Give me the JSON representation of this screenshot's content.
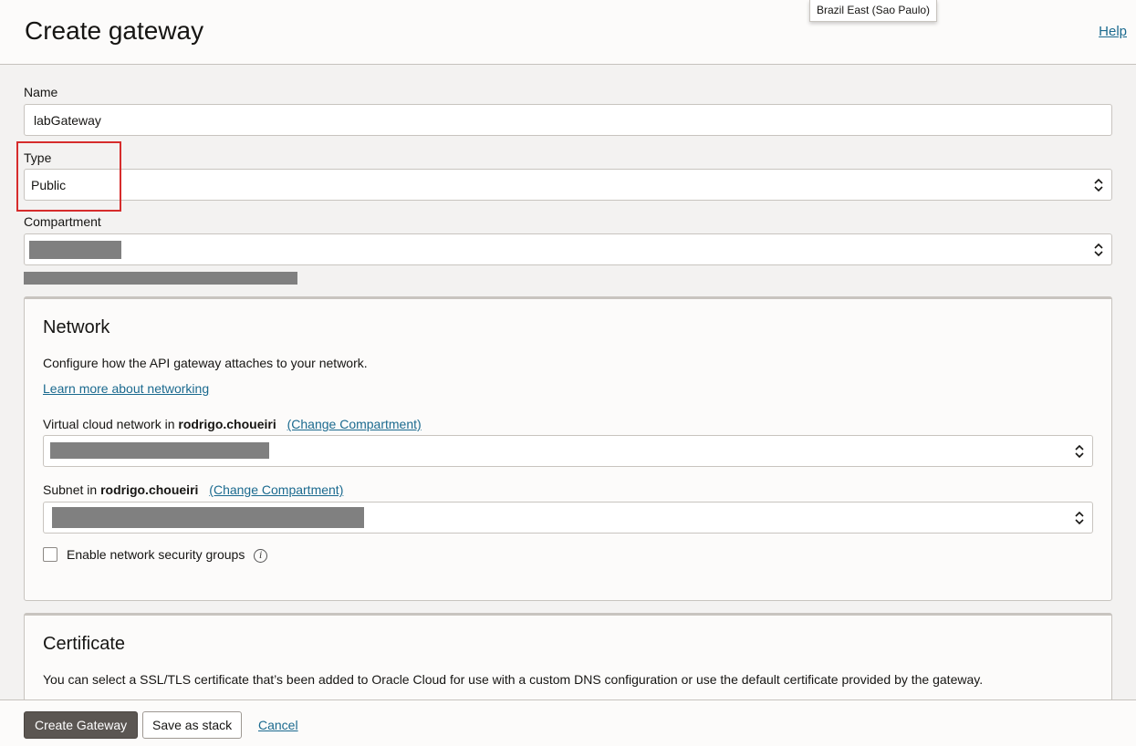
{
  "header": {
    "title": "Create gateway",
    "help_label": "Help",
    "region_tooltip": "Brazil East (Sao Paulo)"
  },
  "form": {
    "name_label": "Name",
    "name_value": "labGateway",
    "type_label": "Type",
    "type_value": "Public",
    "compartment_label": "Compartment"
  },
  "network": {
    "title": "Network",
    "description": "Configure how the API gateway attaches to your network.",
    "learn_more_link": "Learn more about networking",
    "vcn_label_prefix": "Virtual cloud network in",
    "vcn_compartment": "rodrigo.choueiri",
    "vcn_change_link": "(Change Compartment)",
    "subnet_label_prefix": "Subnet in",
    "subnet_compartment": "rodrigo.choueiri",
    "subnet_change_link": "(Change Compartment)",
    "nsg_label": "Enable network security groups",
    "nsg_checked": false
  },
  "certificate": {
    "title": "Certificate",
    "description": "You can select a SSL/TLS certificate that’s been added to Oracle Cloud for use with a custom DNS configuration or use the default certificate provided by the gateway."
  },
  "footer": {
    "create_label": "Create Gateway",
    "save_stack_label": "Save as stack",
    "cancel_label": "Cancel"
  },
  "colors": {
    "link": "#1b6a8f",
    "primary_button": "#5b5652",
    "highlight": "#d62c2c",
    "redaction": "#808080"
  }
}
